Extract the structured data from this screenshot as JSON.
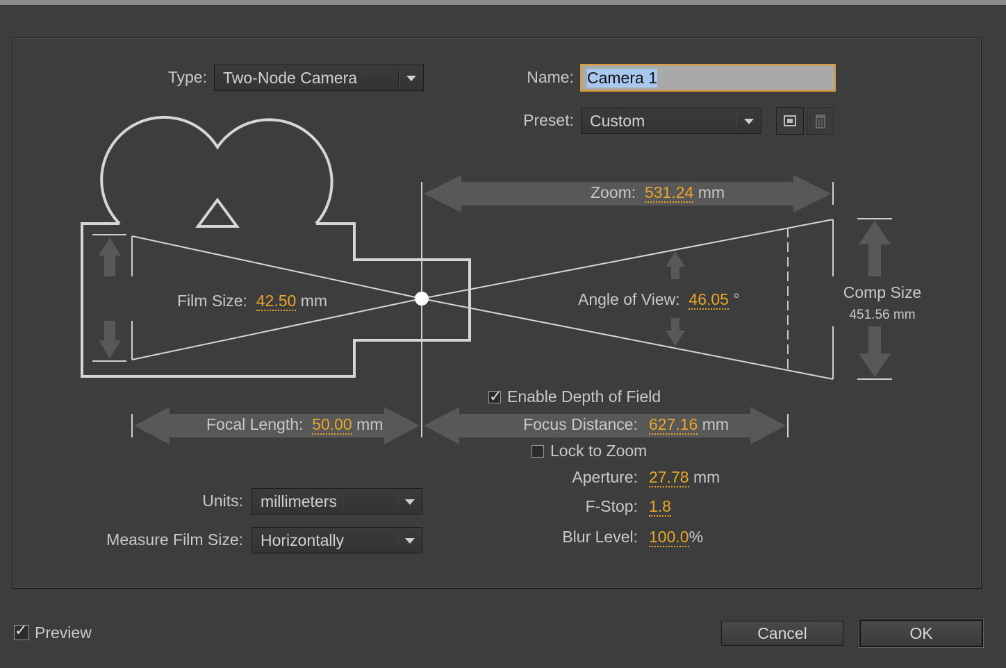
{
  "dialog": {
    "type_label": "Type:",
    "type_value": "Two-Node Camera",
    "name_label": "Name:",
    "name_value": "Camera 1",
    "preset_label": "Preset:",
    "preset_value": "Custom"
  },
  "diagram": {
    "zoom_label": "Zoom:",
    "zoom_value": "531.24",
    "zoom_unit": "mm",
    "film_size_label": "Film Size:",
    "film_size_value": "42.50",
    "film_size_unit": "mm",
    "angle_label": "Angle of View:",
    "angle_value": "46.05",
    "angle_unit": "°",
    "comp_size_label": "Comp Size",
    "comp_size_value": "451.56 mm",
    "focal_length_label": "Focal Length:",
    "focal_length_value": "50.00",
    "focal_length_unit": "mm",
    "focus_distance_label": "Focus Distance:",
    "focus_distance_value": "627.16",
    "focus_distance_unit": "mm"
  },
  "dof": {
    "enable_label": "Enable Depth of Field",
    "enable_checked": true,
    "lock_label": "Lock to Zoom",
    "lock_checked": false,
    "aperture_label": "Aperture:",
    "aperture_value": "27.78",
    "aperture_unit": "mm",
    "fstop_label": "F-Stop:",
    "fstop_value": "1.8",
    "blur_label": "Blur Level:",
    "blur_value": "100.0",
    "blur_unit": "%"
  },
  "settings": {
    "units_label": "Units:",
    "units_value": "millimeters",
    "measure_label": "Measure Film Size:",
    "measure_value": "Horizontally"
  },
  "footer": {
    "preview_label": "Preview",
    "preview_checked": true,
    "cancel_label": "Cancel",
    "ok_label": "OK"
  },
  "colors": {
    "background": "#3d3d3d",
    "value_accent": "#e9a628",
    "focus_border": "#e09a2a"
  },
  "icons": [
    "save-preset-icon",
    "delete-preset-icon",
    "chevron-down-icon",
    "checkmark-icon"
  ]
}
